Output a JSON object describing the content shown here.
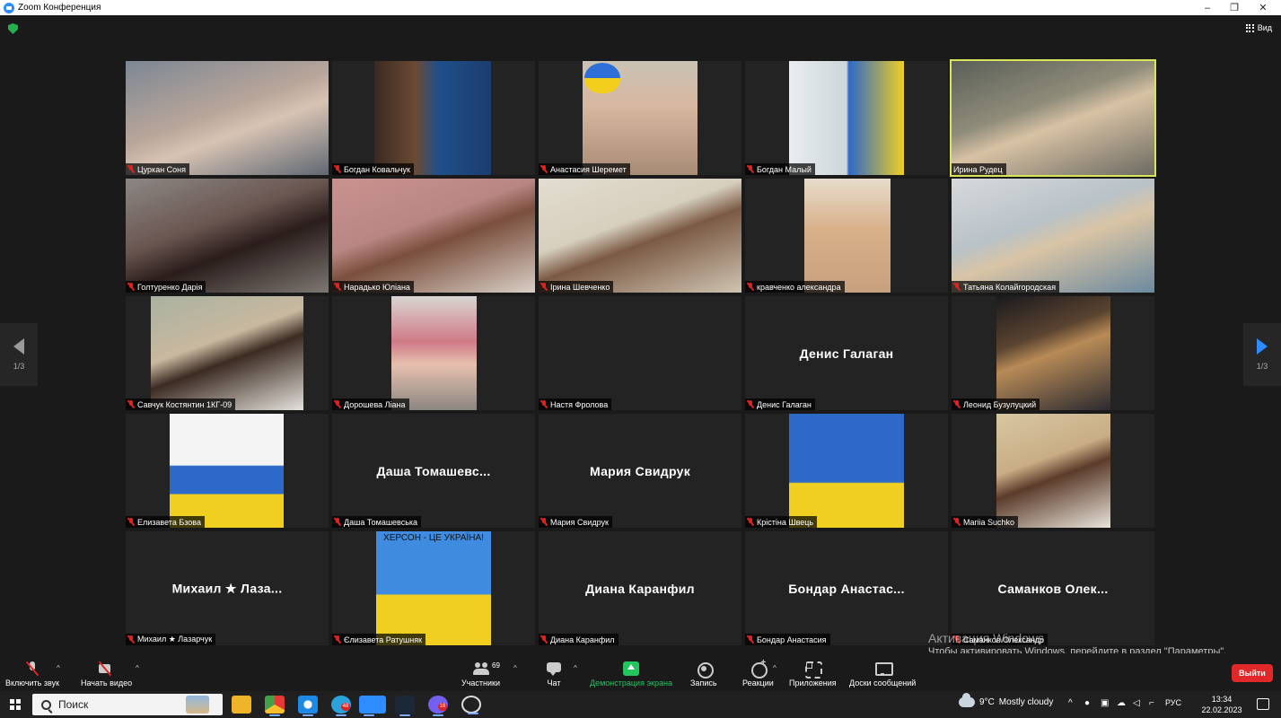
{
  "window": {
    "title": "Zoom Конференция",
    "minimize": "–",
    "maximize": "❐",
    "close": "✕"
  },
  "top": {
    "view_label": "Вид"
  },
  "paging": {
    "left_label": "1/3",
    "right_label": "1/3"
  },
  "tiles": [
    {
      "name": "Цуркан Соня",
      "display": "video",
      "muted": true
    },
    {
      "name": "Богдан Ковальчук",
      "display": "video",
      "muted": true
    },
    {
      "name": "Анастасия Шеремет",
      "display": "video",
      "muted": true
    },
    {
      "name": "Богдан Малый",
      "display": "video",
      "muted": true
    },
    {
      "name": "Ирина Рудец",
      "display": "video",
      "muted": false,
      "active_speaker": true
    },
    {
      "name": "Голтуренко Дарія",
      "display": "video",
      "muted": true
    },
    {
      "name": "Нарадько Юліана",
      "display": "video",
      "muted": true
    },
    {
      "name": "Ірина Шевченко",
      "display": "video",
      "muted": true
    },
    {
      "name": "кравченко александра",
      "display": "video",
      "muted": true
    },
    {
      "name": "Татьяна Колайгородская",
      "display": "video",
      "muted": true
    },
    {
      "name": "Савчук Костянтин 1КГ-09",
      "display": "video",
      "muted": true
    },
    {
      "name": "Дорошева Ліана",
      "display": "video",
      "muted": true
    },
    {
      "name": "Настя Фролова",
      "display": "blank",
      "muted": true
    },
    {
      "name": "Денис Галаган",
      "display": "name",
      "big_name": "Денис Галаган",
      "muted": true
    },
    {
      "name": "Леонид Бузулуцкий",
      "display": "video",
      "muted": true
    },
    {
      "name": "Елизавета Бзова",
      "display": "video",
      "muted": true
    },
    {
      "name": "Даша Томашевська",
      "display": "name",
      "big_name": "Даша Томашевс...",
      "muted": true
    },
    {
      "name": "Мария Свидрук",
      "display": "name",
      "big_name": "Мария Свидрук",
      "muted": true
    },
    {
      "name": "Крістіна Швець",
      "display": "video",
      "muted": true
    },
    {
      "name": "Mariia Suchko",
      "display": "video",
      "muted": true
    },
    {
      "name": "Михаил ★ Лазарчук",
      "display": "name",
      "big_name": "Михаил ★ Лаза...",
      "muted": true
    },
    {
      "name": "Єлизавета Ратушняк",
      "display": "video",
      "muted": true,
      "poster_text": "ХЕРСОН - ЦЕ УКРАЇНА!"
    },
    {
      "name": "Диана Каранфил",
      "display": "name",
      "big_name": "Диана Каранфил",
      "muted": true
    },
    {
      "name": "Бондар Анастасия",
      "display": "name",
      "big_name": "Бондар Анастас...",
      "muted": true
    },
    {
      "name": "Саманков Олександр",
      "display": "name",
      "big_name": "Саманков Олек...",
      "muted": true
    }
  ],
  "watermark": {
    "line1": "Активация Windows",
    "line2": "Чтобы активировать Windows, перейдите в раздел \"Параметры\"."
  },
  "toolbar": {
    "unmute": "Включить звук",
    "start_video": "Начать видео",
    "participants": "Участники",
    "participants_count": "69",
    "chat": "Чат",
    "share": "Демонстрация экрана",
    "record": "Запись",
    "reactions": "Реакции",
    "apps": "Приложения",
    "whiteboards": "Доски сообщений",
    "leave": "Выйти"
  },
  "taskbar": {
    "search": "Поиск",
    "telegram_badge": "48",
    "viber_badge": "16",
    "weather_temp": "9°C",
    "weather_text": "Mostly cloudy",
    "lang": "РУС",
    "time": "13:34",
    "date": "22.02.2023"
  }
}
